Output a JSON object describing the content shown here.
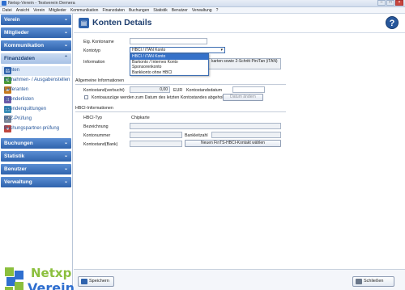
{
  "window": {
    "title": "Netxp-Verein - Testverein Demera"
  },
  "menubar": [
    "Datei",
    "Ansicht",
    "Verein",
    "Mitglieder",
    "Kommunikation",
    "Finanzdaten",
    "Buchungen",
    "Statistik",
    "Benutzer",
    "Verwaltung",
    "?"
  ],
  "sidebar": {
    "groups": [
      {
        "label": "Verein"
      },
      {
        "label": "Mitglieder"
      },
      {
        "label": "Kommunikation"
      },
      {
        "label": "Finanzdaten"
      }
    ],
    "finanz_items": [
      {
        "label": "Konten",
        "icon": "bank-icon",
        "color": "#2f63ad"
      },
      {
        "label": "Einnahmen- / Ausgabenstellen",
        "icon": "money-icon",
        "color": "#4b9b3a"
      },
      {
        "label": "Lieferanten",
        "icon": "truck-icon",
        "color": "#c77a1d"
      },
      {
        "label": "Spenderlisten",
        "icon": "list-icon",
        "color": "#6b5aa8"
      },
      {
        "label": "Spendenquittungen",
        "icon": "receipt-icon",
        "color": "#3a8fb7"
      },
      {
        "label": "BLZ-Prüfung",
        "icon": "check-icon",
        "color": "#7a8696"
      },
      {
        "label": "Buchungspartner-prüfung",
        "icon": "partner-icon",
        "color": "#c0463d"
      }
    ],
    "lower_groups": [
      {
        "label": "Buchungen"
      },
      {
        "label": "Statistik"
      },
      {
        "label": "Benutzer"
      },
      {
        "label": "Verwaltung"
      }
    ],
    "logo": {
      "line1": "Netxp",
      "line2": "Verein"
    }
  },
  "header": {
    "title": "Konten Details",
    "help": "?"
  },
  "form": {
    "kontoname_label": "Eig. Kontoname",
    "kontoname_value": "",
    "kontotyp_label": "Kontotyp",
    "kontotyp_value": "HBCI / iTAN Konto",
    "kontotyp_options": [
      "HBCI / iTAN Konto",
      "Barkonto / Internes Konto",
      "Sponsorenkonto",
      "Bankkonto ohne HBCI"
    ],
    "information_label": "Information",
    "information_text": "karten sowie 2-Schritt Pin/Tan (iTAN)",
    "allgemein_section": "Allgemeine Informationen",
    "kontostand_label": "Kontostand(verbucht)",
    "kontostand_value": "0,00",
    "currency": "EUR",
    "kontostandsdatum_label": "Kontostandsdatum",
    "kontoauszuege_text": "Kontoauszüge werden zum Datum des letzten Kontostandes abgeholt",
    "datum_button": "Datum ändern",
    "hbci_section": "HBCI-Informationen",
    "hbci_typ_label": "HBCI-Typ",
    "hbci_typ_value": "Chipkarte",
    "bezeichnung_label": "Bezeichnung",
    "kontonummer_label": "Kontonummer",
    "bankleitzahl_label": "Bankleitzahl",
    "kontostand_bank_label": "Kontostand(Bank)",
    "fints_button": "Neuen FinTS-HBCI-Kontakt wählen"
  },
  "footer": {
    "save": "Speichern",
    "close": "Schließen"
  }
}
